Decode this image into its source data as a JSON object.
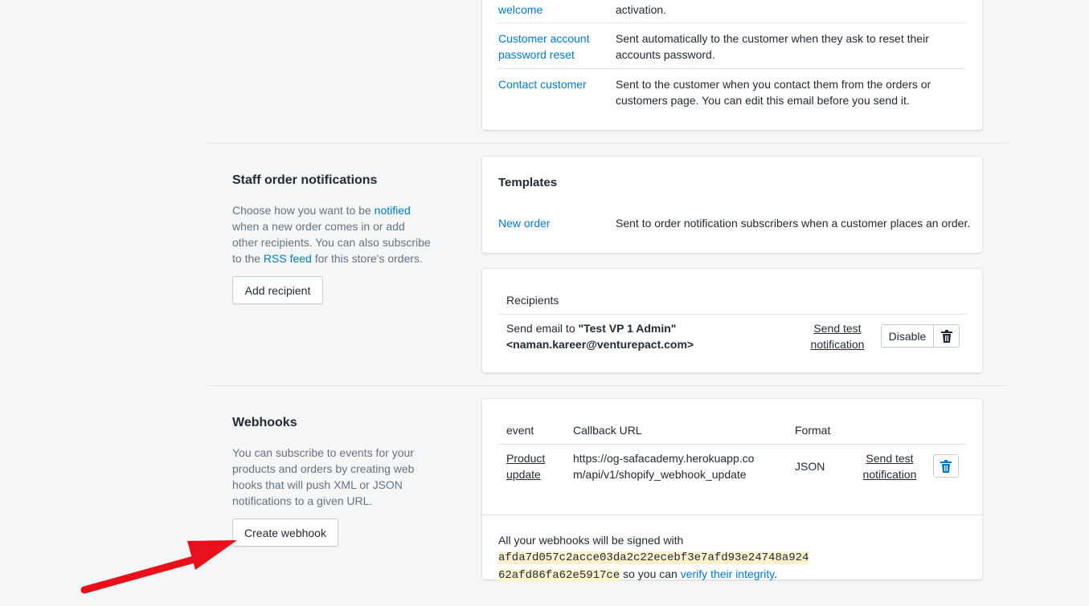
{
  "customer_templates": {
    "rows": [
      {
        "name": "welcome",
        "desc": "activation."
      },
      {
        "name": "Customer account password reset",
        "desc": "Sent automatically to the customer when they ask to reset their accounts password."
      },
      {
        "name": "Contact customer",
        "desc": "Sent to the customer when you contact them from the orders or customers page. You can edit this email before you send it."
      }
    ]
  },
  "staff": {
    "title": "Staff order notifications",
    "desc_1": "Choose how you want to be ",
    "desc_link_1": "notified",
    "desc_2": " when a new order comes in or add other recipients. You can also subscribe to the ",
    "desc_link_2": "RSS feed",
    "desc_3": " for this store's orders.",
    "add_recipient_label": "Add recipient",
    "templates_heading": "Templates",
    "template_name": "New order",
    "template_desc": "Sent to order notification subscribers when a customer places an order.",
    "recipients_heading": "Recipients",
    "recipient_prefix": "Send email to ",
    "recipient_name": "\"Test VP 1 Admin\"",
    "recipient_email": "<naman.kareer@venturepact.com>",
    "send_test_label": "Send test notification",
    "disable_label": "Disable",
    "icons": {
      "delete": "trash-icon"
    }
  },
  "webhooks": {
    "title": "Webhooks",
    "desc": "You can subscribe to events for your products and orders by creating web hooks that will push XML or JSON notifications to a given URL.",
    "create_label": "Create webhook",
    "columns": {
      "event": "event",
      "url": "Callback URL",
      "format": "Format"
    },
    "row": {
      "event": "Product update",
      "url": "https://og-safacademy.herokuapp.com/api/v1/shopify_webhook_update",
      "format": "JSON",
      "send_test_label": "Send test notification"
    },
    "sig_prefix": "All your webhooks will be signed with ",
    "sig_key_1": "afda7d057c2acce03da2c22ecebf3e7afd93e24748a924",
    "sig_key_2": "62afd86fa62e5917ce",
    "sig_mid": " so you can ",
    "sig_link": "verify their integrity",
    "sig_end": ".",
    "icons": {
      "delete": "trash-icon"
    }
  },
  "annotation": {
    "icon": "red-arrow-icon",
    "color": "#e8111a"
  }
}
